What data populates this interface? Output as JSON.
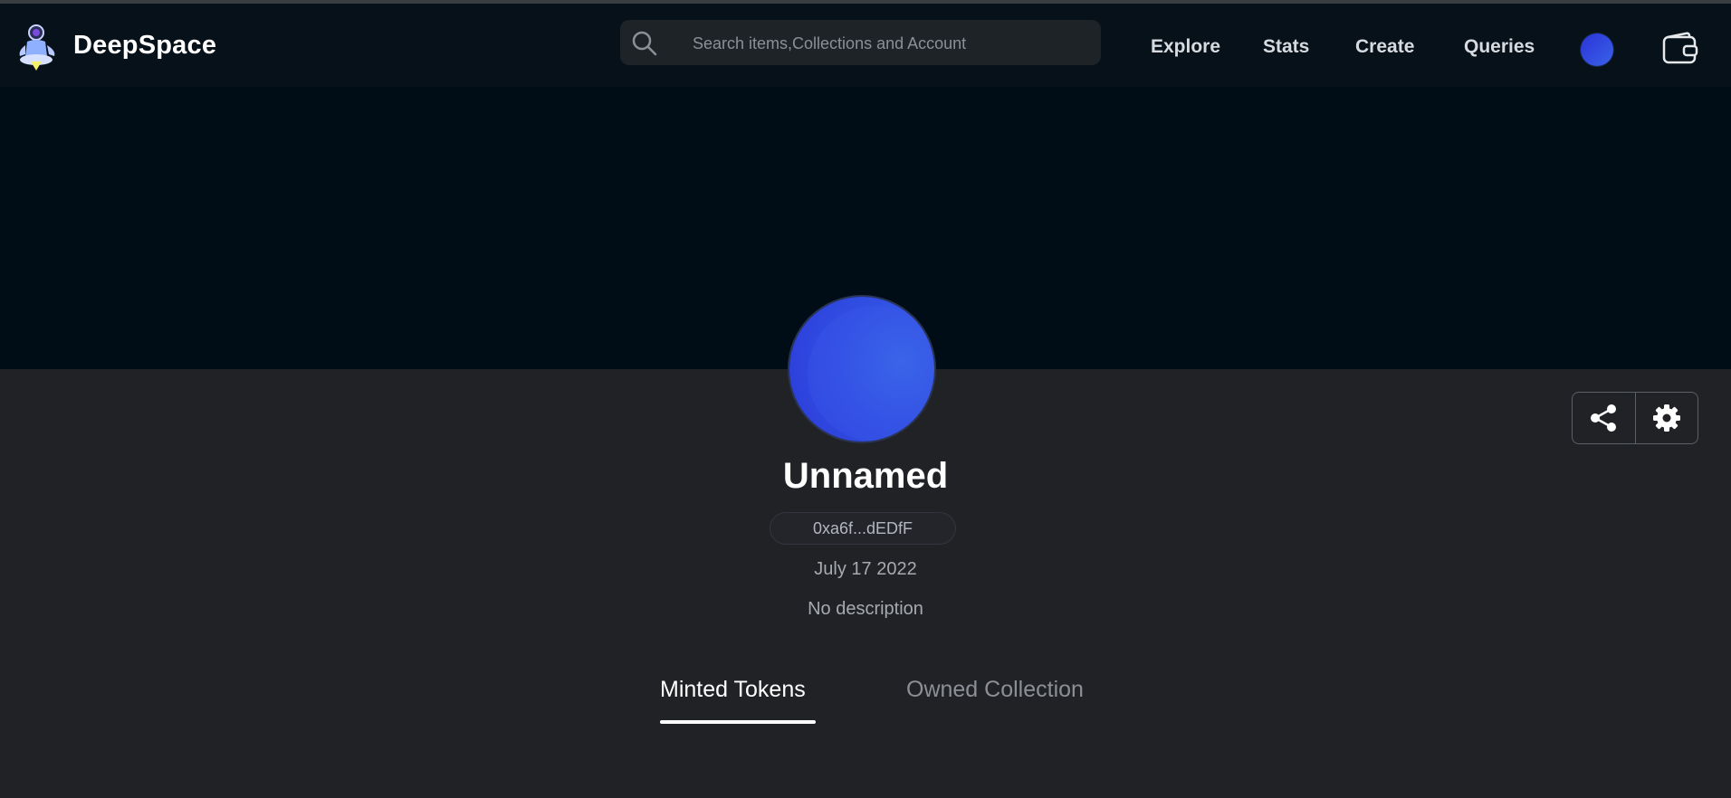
{
  "brand": {
    "name": "DeepSpace"
  },
  "search": {
    "placeholder": "Search items,Collections and Account"
  },
  "nav": {
    "links": [
      "Explore",
      "Stats",
      "Create",
      "Queries"
    ]
  },
  "profile": {
    "name": "Unnamed",
    "address": "0xa6f...dEDfF",
    "joined": "July 17 2022",
    "description": "No description"
  },
  "tabs": [
    {
      "label": "Minted Tokens",
      "active": true
    },
    {
      "label": "Owned Collection",
      "active": false
    }
  ],
  "icons": {
    "search": "search-icon",
    "wallet": "wallet-icon",
    "share": "share-icon",
    "settings": "gear-icon"
  },
  "colors": {
    "navbar": "#06111a",
    "banner": "#000d16",
    "page": "#212226",
    "avatar": "#3151e3"
  }
}
